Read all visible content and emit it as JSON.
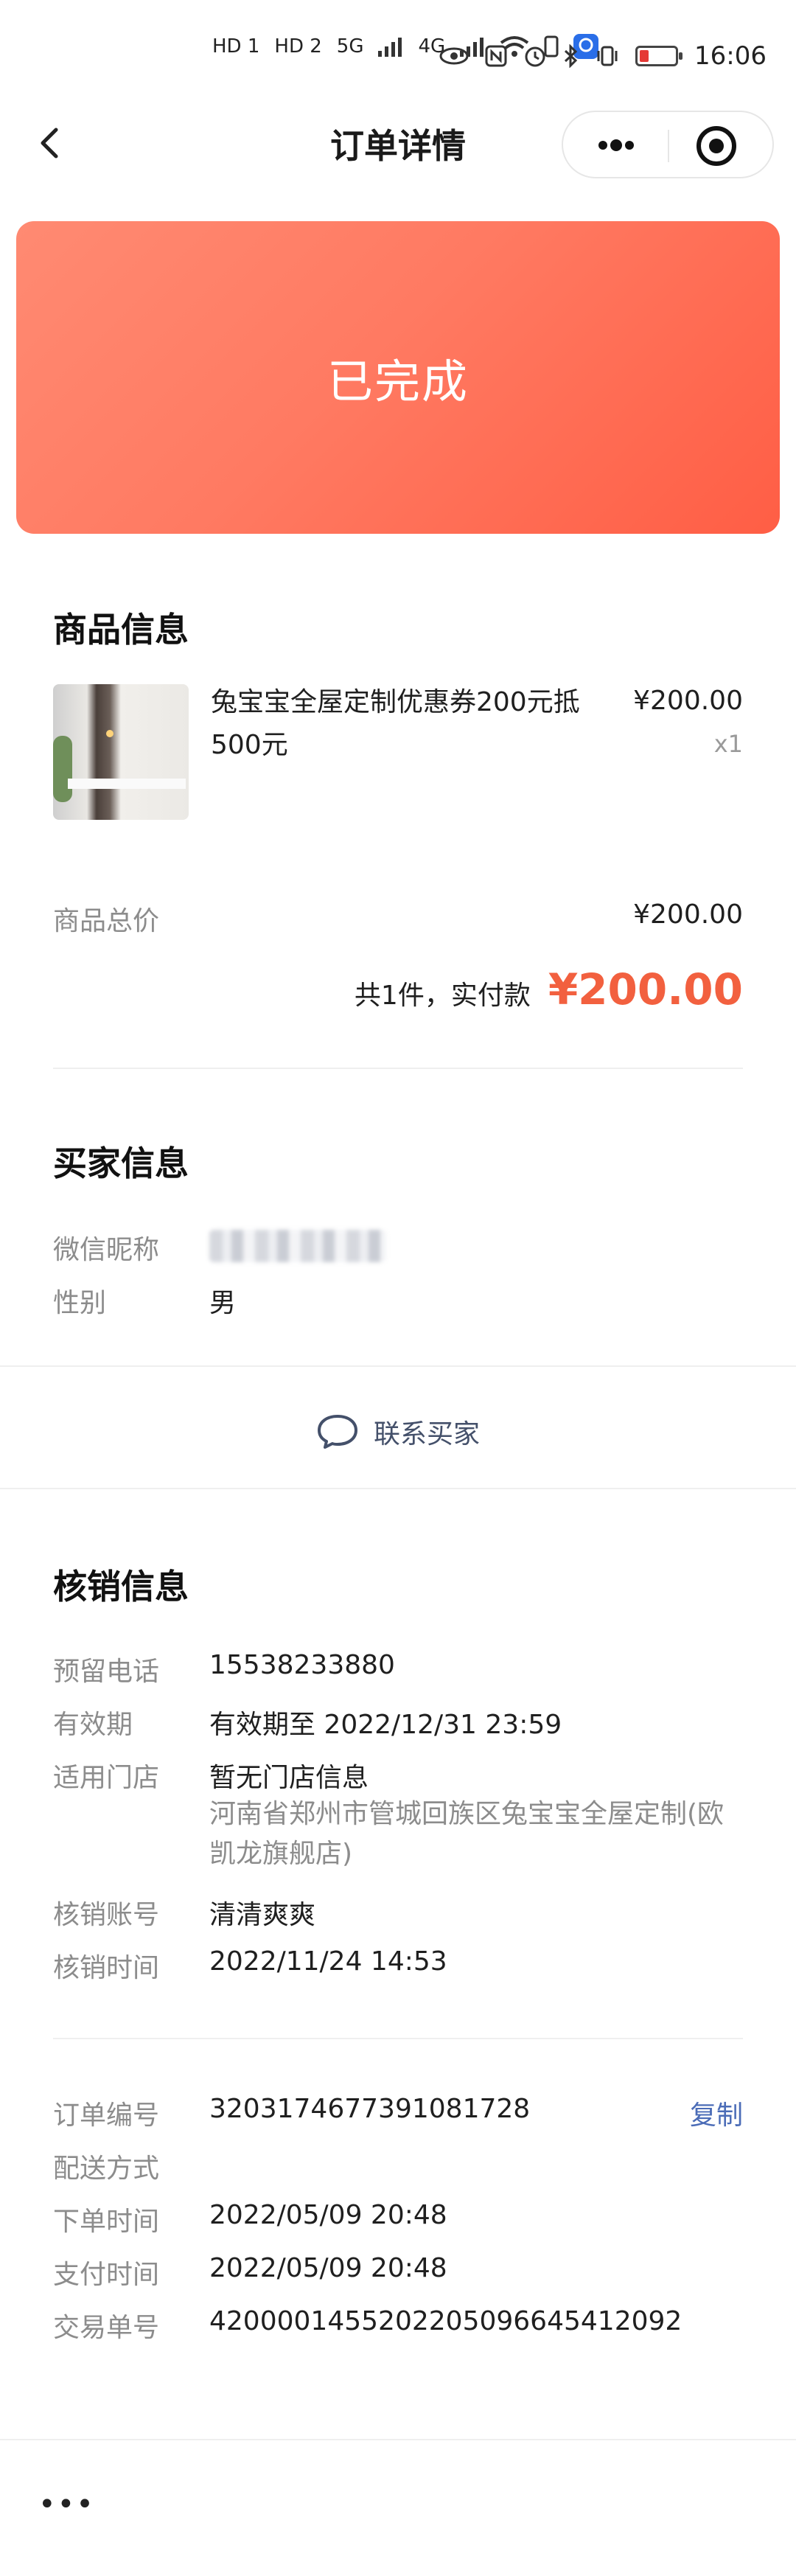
{
  "status_bar": {
    "signal_labels": [
      "HD 1",
      "HD 2",
      "5G",
      "4G"
    ],
    "time": "16:06"
  },
  "navbar": {
    "title": "订单详情"
  },
  "order_status": {
    "text": "已完成",
    "gradient_start": "#ff8a72",
    "gradient_end": "#ff5e45"
  },
  "product_section": {
    "title": "商品信息",
    "product": {
      "name": "兔宝宝全屋定制优惠券200元抵500元",
      "price": "¥200.00",
      "quantity": "x1"
    },
    "total_label": "商品总价",
    "total_value": "¥200.00",
    "paid_text": "共1件，实付款",
    "paid_amount": "¥200.00",
    "accent_color": "#f2603f"
  },
  "buyer_section": {
    "title": "买家信息",
    "nickname_label": "微信昵称",
    "gender_label": "性别",
    "gender_value": "男",
    "contact_button": "联系买家"
  },
  "verify_section": {
    "title": "核销信息",
    "rows": [
      {
        "label": "预留电话",
        "value": "15538233880"
      },
      {
        "label": "有效期",
        "value": "有效期至 2022/12/31 23:59"
      },
      {
        "label": "适用门店",
        "value": "暂无门店信息",
        "sub": "河南省郑州市管城回族区兔宝宝全屋定制(欧凯龙旗舰店)"
      },
      {
        "label": "核销账号",
        "value": "清清爽爽"
      },
      {
        "label": "核销时间",
        "value": "2022/11/24 14:53"
      }
    ]
  },
  "order_section": {
    "rows": [
      {
        "label": "订单编号",
        "value": "3203174677391081728"
      },
      {
        "label": "配送方式",
        "value": ""
      },
      {
        "label": "下单时间",
        "value": "2022/05/09 20:48"
      },
      {
        "label": "支付时间",
        "value": "2022/05/09 20:48"
      },
      {
        "label": "交易单号",
        "value": "4200001455202205096645412092"
      }
    ],
    "copy_label": "复制",
    "link_color": "#4b6cb7"
  },
  "bottom_bar": {
    "more_label": "•••"
  }
}
